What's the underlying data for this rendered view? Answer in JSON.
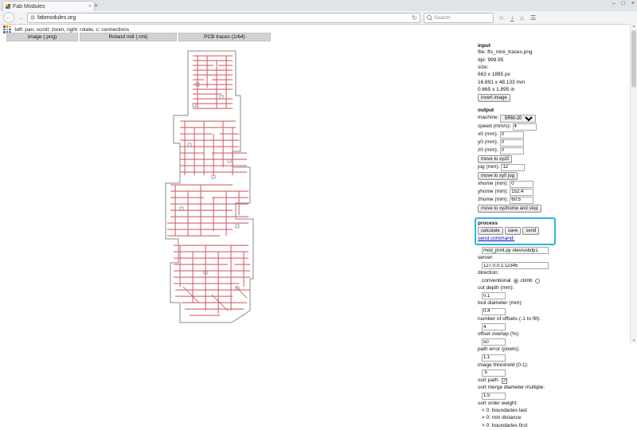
{
  "browser": {
    "tab": {
      "title": "Fab Modules",
      "close_icon": "×",
      "new_tab_icon": "+"
    },
    "window_controls": {
      "minimize": "–",
      "maximize": "□",
      "close": "×"
    },
    "nav": {
      "back_icon": "←",
      "forward_icon": "→",
      "reload_icon": "↻",
      "url": "fabmodules.org",
      "search_placeholder": "Search",
      "star_icon": "☆",
      "download_icon": "↓",
      "home_icon": "⌂",
      "menu_icon": "☰"
    }
  },
  "app": {
    "hint": "left: pan, scroll: zoom, right: rotate, c: connections",
    "menus": [
      "image (.png)",
      "Roland mill (.rml)",
      "PCB traces (1/64)"
    ]
  },
  "input_panel": {
    "title": "input",
    "file_label": "file:",
    "file_value": "fts_mini_traces.png",
    "dpi_label": "dpi:",
    "dpi_value": "999.95",
    "size_label": "size:",
    "size_px": "663 x 1895 px",
    "size_mm": "16.891 x 48.133 mm",
    "size_in": "0.665 x 1.895 in",
    "invert_button": "invert image"
  },
  "output_panel": {
    "title": "output",
    "machine_label": "machine:",
    "machine_value": "SRM-20",
    "rows": [
      {
        "label": "speed (mm/s):",
        "value": "4"
      },
      {
        "label": "x0 (mm):",
        "value": "0"
      },
      {
        "label": "y0 (mm):",
        "value": "0"
      },
      {
        "label": "z0 (mm):",
        "value": "0"
      },
      {
        "label": "jog (mm):",
        "value": "12"
      },
      {
        "label": "xhome (mm):",
        "value": "0"
      },
      {
        "label": "yhome (mm):",
        "value": "152.4"
      },
      {
        "label": "zhome (mm):",
        "value": "60.5"
      }
    ],
    "move_xyz0_button": "move to xyz0",
    "move_xy0_jog_button": "move to xy0 jog",
    "move_home_button": "move to xyzhome and stop"
  },
  "process_panel": {
    "title": "process",
    "calculate_button": "calculate",
    "save_button": "save",
    "send_button": "send",
    "send_command_label": "send command:",
    "send_command_value": "mod_print.py /dev/usb/lp1",
    "server_label": "server:",
    "server_value": "127.0.0.1:12345",
    "direction_label": "direction:",
    "direction_options": [
      "conventional",
      "climb"
    ],
    "direction_conventional_checked": true,
    "fields": [
      {
        "label": "cut depth (mm):",
        "value": "0.1"
      },
      {
        "label": "tool diameter (mm):",
        "value": "0.4"
      },
      {
        "label": "number of offsets (-1 to fill):",
        "value": "4"
      },
      {
        "label": "offset overlap (%):",
        "value": "50"
      },
      {
        "label": "path error (pixels):",
        "value": "1.1"
      },
      {
        "label": "image threshold (0-1):",
        "value": ".5"
      }
    ],
    "sort_path_label": "sort path:",
    "sort_path_checked": true,
    "sort_merge_label": "sort merge diameter multiple:",
    "sort_merge_value": "1.5",
    "sort_order_label": "sort order weight:",
    "sort_order_lines": [
      "< 0: boundaries last",
      "= 0: min distance",
      "> 0: boundaries first"
    ]
  },
  "colors": {
    "annotation": "#29b8d8",
    "trace_red": "#c84a50",
    "trace_pink": "#f2b8c0",
    "board_gray": "#8a8a8a"
  }
}
